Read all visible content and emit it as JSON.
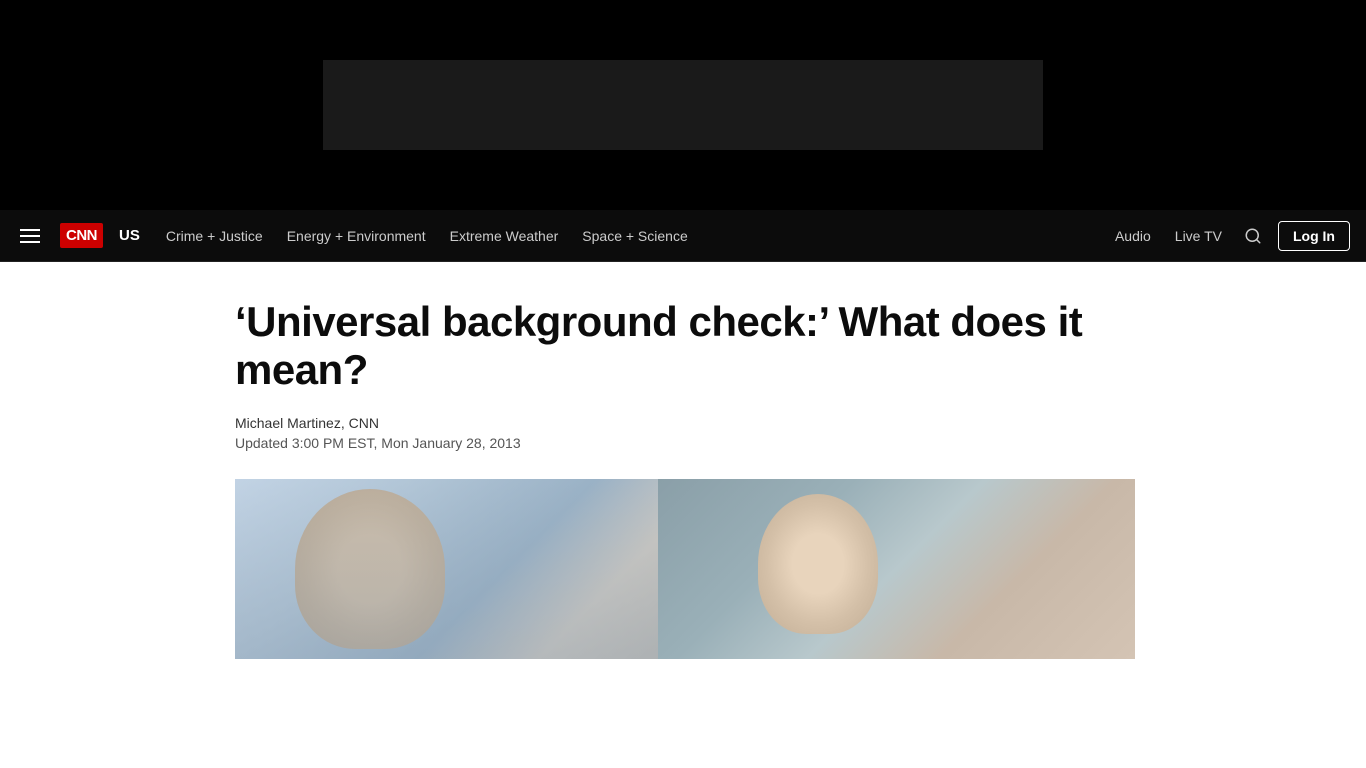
{
  "topBanner": {
    "adAlt": "Advertisement"
  },
  "navbar": {
    "logo": "CNN",
    "sectionLabel": "US",
    "navLinks": [
      {
        "id": "crime-justice",
        "label": "Crime + Justice"
      },
      {
        "id": "energy-environment",
        "label": "Energy + Environment"
      },
      {
        "id": "extreme-weather",
        "label": "Extreme Weather"
      },
      {
        "id": "space-science",
        "label": "Space + Science"
      }
    ],
    "rightLinks": [
      {
        "id": "audio",
        "label": "Audio"
      },
      {
        "id": "live-tv",
        "label": "Live TV"
      }
    ],
    "loginLabel": "Log In",
    "searchAriaLabel": "Search"
  },
  "article": {
    "title": "‘Universal background check:’ What does it mean?",
    "author": "Michael Martinez, CNN",
    "timestamp": "Updated 3:00 PM EST, Mon January 28, 2013"
  }
}
